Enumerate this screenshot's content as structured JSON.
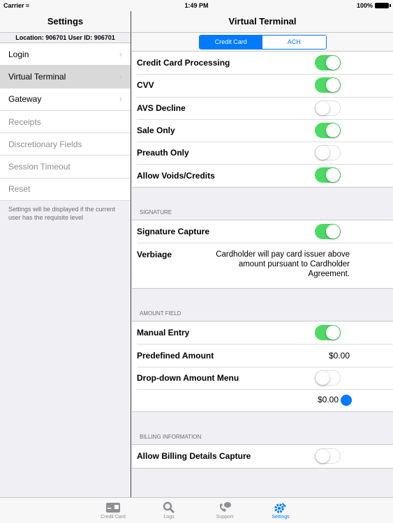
{
  "status": {
    "carrier": "Carrier",
    "time": "1:49 PM",
    "battery": "100%"
  },
  "master": {
    "title": "Settings",
    "location_line": "Location: 906701 User ID: 906701",
    "items": [
      {
        "label": "Login",
        "chevron": true,
        "state": "enabled"
      },
      {
        "label": "Virtual Terminal",
        "chevron": true,
        "state": "selected"
      },
      {
        "label": "Gateway",
        "chevron": true,
        "state": "enabled"
      },
      {
        "label": "Receipts",
        "chevron": false,
        "state": "disabled"
      },
      {
        "label": "Discretionary Fields",
        "chevron": false,
        "state": "disabled"
      },
      {
        "label": "Session Timeout",
        "chevron": false,
        "state": "disabled"
      },
      {
        "label": "Reset",
        "chevron": false,
        "state": "disabled"
      }
    ],
    "footnote": "Settings will be displayed if the current user has the requisite level"
  },
  "detail": {
    "title": "Virtual Terminal",
    "segments": [
      "Credit Card",
      "ACH"
    ],
    "selected_segment": "Credit Card",
    "general": [
      {
        "label": "Credit Card Processing",
        "on": true
      },
      {
        "label": "CVV",
        "on": true
      },
      {
        "label": "AVS Decline",
        "on": false
      },
      {
        "label": "Sale Only",
        "on": true
      },
      {
        "label": "Preauth Only",
        "on": false
      },
      {
        "label": "Allow Voids/Credits",
        "on": true
      }
    ],
    "signature": {
      "header": "SIGNATURE",
      "capture_label": "Signature Capture",
      "capture_on": true,
      "verbiage_label": "Verbiage",
      "verbiage_text": "Cardholder will pay card issuer above amount pursuant to Cardholder Agreement."
    },
    "amount": {
      "header": "AMOUNT FIELD",
      "manual_entry_label": "Manual Entry",
      "manual_entry_on": true,
      "predefined_label": "Predefined Amount",
      "predefined_value": "$0.00",
      "dropdown_label": "Drop-down Amount Menu",
      "dropdown_on": false,
      "dropdown_value": "$0.00"
    },
    "billing": {
      "header": "BILLING INFORMATION",
      "label": "Allow Billing Details Capture",
      "on": false
    }
  },
  "tabbar": [
    {
      "label": "Credit Card",
      "icon": "credit-card-icon",
      "active": false
    },
    {
      "label": "Logs",
      "icon": "search-icon",
      "active": false
    },
    {
      "label": "Support",
      "icon": "support-phone-icon",
      "active": false
    },
    {
      "label": "Settings",
      "icon": "gear-icon",
      "active": true
    }
  ],
  "colors": {
    "accent": "#007aff",
    "toggle_on": "#4cd964"
  }
}
